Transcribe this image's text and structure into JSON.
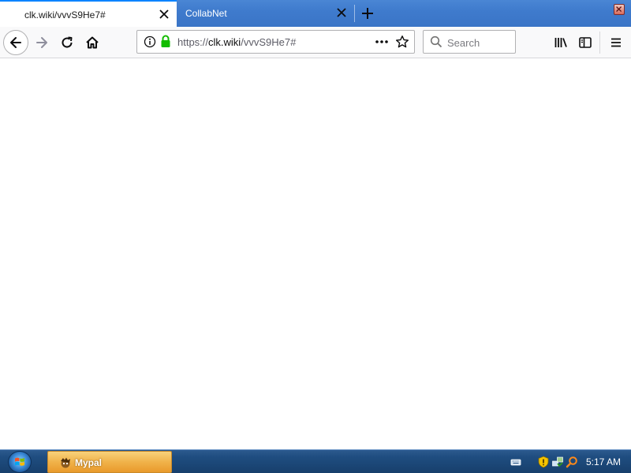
{
  "tabs": [
    {
      "title": "clk.wiki/vvvS9He7#",
      "active": true
    },
    {
      "title": "CollabNet",
      "active": false
    }
  ],
  "urlbar": {
    "scheme": "https://",
    "host": "clk.wiki",
    "path": "/vvvS9He7#"
  },
  "search": {
    "placeholder": "Search"
  },
  "icons": {
    "back": "back-arrow-icon",
    "forward": "forward-arrow-icon",
    "reload": "reload-icon",
    "home": "home-icon",
    "info": "info-icon",
    "lock": "lock-icon",
    "page_actions": "more-horizontal-icon",
    "bookmark": "star-icon",
    "library": "library-icon",
    "sidebar": "sidebar-icon",
    "menu": "hamburger-menu-icon",
    "new_tab": "plus-icon",
    "close_window": "close-window-icon"
  },
  "taskbar": {
    "item_label": "Mypal",
    "clock": "5:17 AM"
  },
  "colors": {
    "accent": "#0a84ff",
    "secure_lock": "#12bc00",
    "tabstrip": "#3f7bcd",
    "taskbar": "#1f4d80",
    "taskbar_item": "#f0b24a"
  }
}
